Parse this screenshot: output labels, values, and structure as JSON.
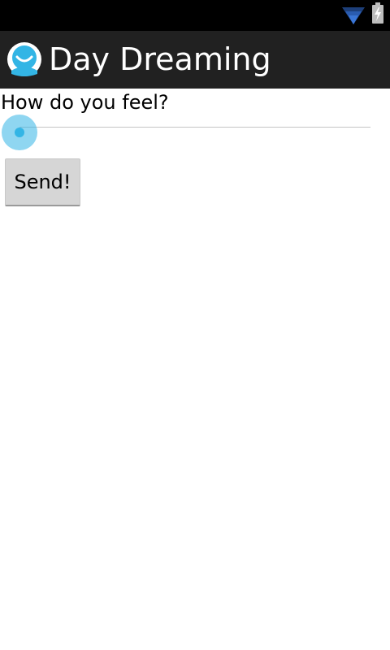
{
  "status_bar": {
    "icons": [
      "wifi-icon",
      "battery-charging-icon"
    ],
    "icon_color": "#1d5bbd"
  },
  "action_bar": {
    "app_icon": "daydream-face-icon",
    "title": "Day Dreaming",
    "background": "#212121"
  },
  "main": {
    "question": "How do you feel?",
    "slider": {
      "value_fraction": 0.0,
      "accent_color": "#33b5e5"
    },
    "send_label": "Send!"
  }
}
